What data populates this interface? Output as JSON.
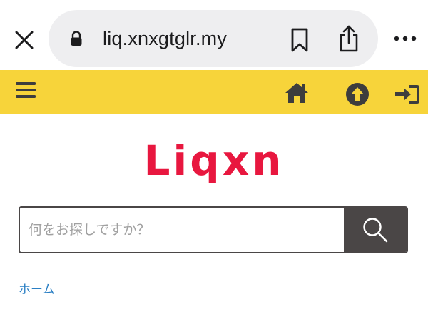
{
  "browser": {
    "url": "liq.xnxgtglr.my",
    "close_icon": "close-icon",
    "lock_icon": "lock-icon",
    "bookmark_icon": "bookmark-icon",
    "share_icon": "share-icon",
    "more_icon": "more-icon"
  },
  "header": {
    "background": "#f7d43a",
    "menu_icon": "hamburger-menu-icon",
    "home_icon": "home-icon",
    "up_icon": "arrow-up-circle-icon",
    "login_icon": "sign-in-icon"
  },
  "logo": {
    "text": "Liqxn",
    "color": "#e8173f"
  },
  "search": {
    "placeholder": "何をお探しですか？",
    "value": "",
    "button_icon": "search-icon",
    "button_color": "#4a4646"
  },
  "breadcrumb": {
    "home_label": "ホーム",
    "color": "#2a7fc4"
  }
}
